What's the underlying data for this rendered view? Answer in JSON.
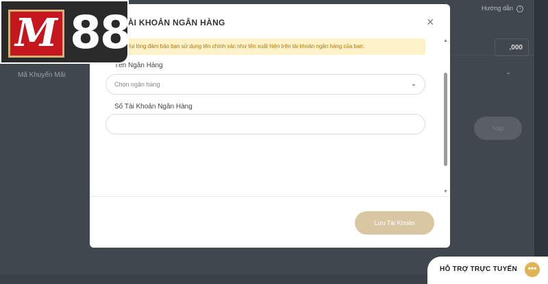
{
  "background": {
    "guide_label": "Hướng dẫn",
    "guide_icon": "info-icon",
    "amount_value": ",000",
    "promo_label": "Mã Khuyến Mãi",
    "submit_label": "Nạp"
  },
  "logo": {
    "m_letter": "M",
    "number": "88"
  },
  "modal": {
    "title": "TÀI KHOẢN NGÂN HÀNG",
    "close_icon": "close-icon",
    "notice": "Vui lòng đảm bảo bạn sử dụng tên chính xác như tên xuất hiện trên tài khoản ngân hàng của bạn.",
    "bank_label": "Tên Ngân Hàng",
    "bank_placeholder": "Chọn ngân hàng",
    "account_label": "Số Tài Khoản Ngân Hàng",
    "account_value": "",
    "save_label": "Lưu Tài Khoản"
  },
  "support": {
    "label": "HỖ TRỢ TRỰC TUYẾN",
    "icon": "chat-icon"
  },
  "colors": {
    "accent_gold": "#d9c7a3",
    "notice_bg": "#fdf1c8",
    "notice_text": "#b0780a",
    "logo_red": "#c4161c",
    "overlay": "#41474f"
  }
}
